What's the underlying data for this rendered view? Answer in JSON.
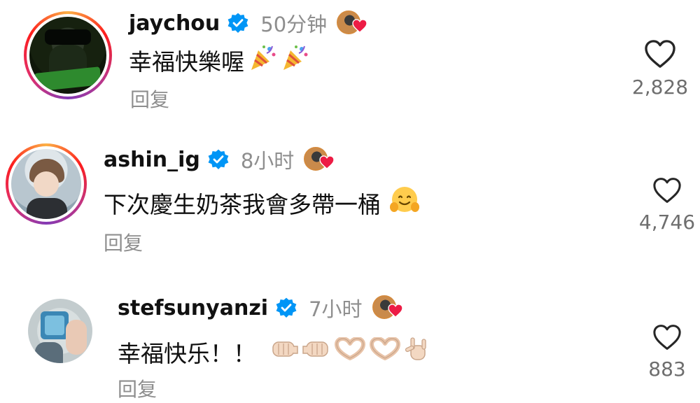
{
  "comments": [
    {
      "username": "jaychou",
      "time": "50分钟",
      "text": "幸福快樂喔",
      "emojis": [
        "party-popper",
        "party-popper"
      ],
      "reply": "回复",
      "likes": "2,828"
    },
    {
      "username": "ashin_ig",
      "time": "8小时",
      "text": "下次慶生奶茶我會多帶一桶",
      "emojis": [
        "hugging-face"
      ],
      "reply": "回复",
      "likes": "4,746"
    },
    {
      "username": "stefsunyanzi",
      "time": "7小时",
      "text": "幸福快乐！！",
      "emojis": [
        "left-facing-fist",
        "right-facing-fist",
        "heart-hands",
        "heart-hands",
        "love-you-gesture"
      ],
      "reply": "回复",
      "likes": "883"
    }
  ],
  "colors": {
    "verified": "#0095f6",
    "heart": "#ed1c45",
    "muted": "#8e8e8e"
  }
}
